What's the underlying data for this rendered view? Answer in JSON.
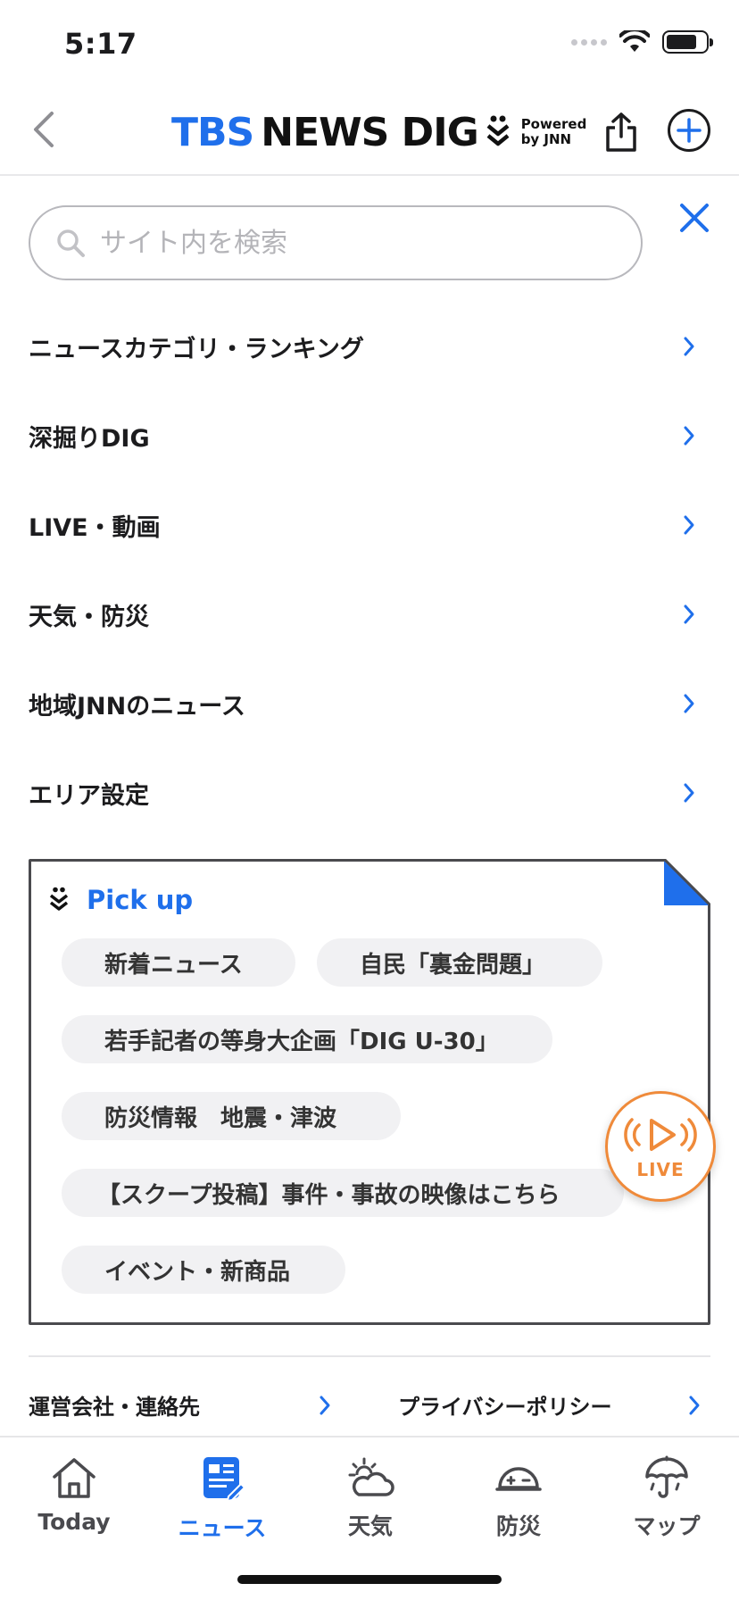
{
  "status_bar": {
    "time": "5:17"
  },
  "header": {
    "logo_tbs": "TBS",
    "logo_news": "NEWS DIG",
    "logo_powered_1": "Powered",
    "logo_powered_2": "by JNN"
  },
  "search": {
    "placeholder": "サイト内を検索"
  },
  "menu": {
    "items": [
      {
        "label": "ニュースカテゴリ・ランキング"
      },
      {
        "label": "深掘りDIG"
      },
      {
        "label": "LIVE・動画"
      },
      {
        "label": "天気・防災"
      },
      {
        "label": "地域JNNのニュース"
      },
      {
        "label": "エリア設定"
      }
    ]
  },
  "pickup": {
    "title": "Pick up",
    "chips": [
      {
        "label": "新着ニュース"
      },
      {
        "label": "自民「裏金問題」"
      },
      {
        "label": "若手記者の等身大企画「DIG U-30」"
      },
      {
        "label": "防災情報　地震・津波"
      },
      {
        "label": "【スクープ投稿】事件・事故の映像はこちら"
      },
      {
        "label": "イベント・新商品"
      }
    ]
  },
  "live_button": {
    "label": "LIVE"
  },
  "footer_links": [
    {
      "label": "運営会社・連絡先"
    },
    {
      "label": "プライバシーポリシー"
    }
  ],
  "tabs": [
    {
      "label": "Today",
      "icon": "home-icon",
      "active": false
    },
    {
      "label": "ニュース",
      "icon": "news-icon",
      "active": true
    },
    {
      "label": "天気",
      "icon": "weather-icon",
      "active": false
    },
    {
      "label": "防災",
      "icon": "helmet-icon",
      "active": false
    },
    {
      "label": "マップ",
      "icon": "map-umbrella-icon",
      "active": false
    }
  ],
  "colors": {
    "accent": "#1f6feb",
    "live": "#ef8a3a",
    "chip_bg": "#f1f1f3"
  }
}
